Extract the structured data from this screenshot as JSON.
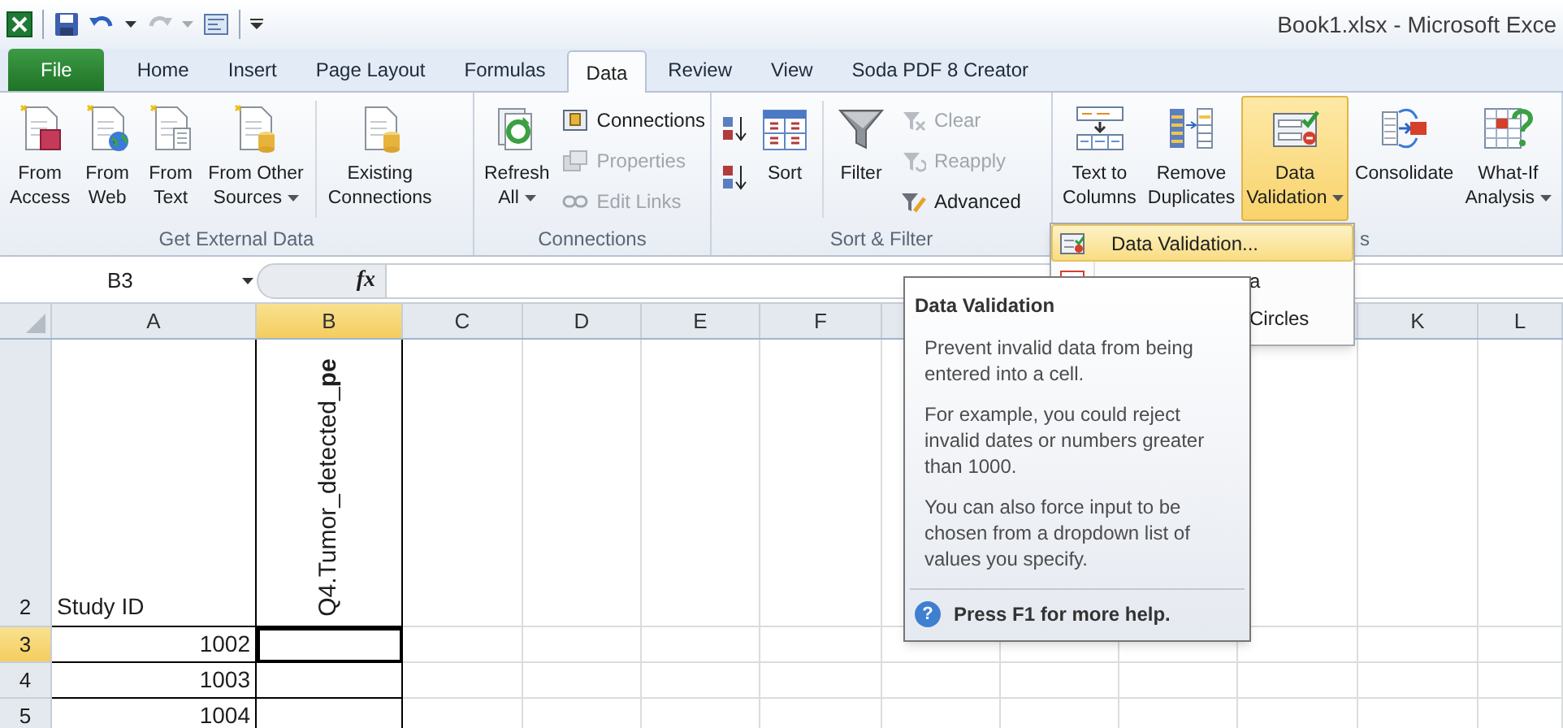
{
  "window": {
    "title": "Book1.xlsx - Microsoft Exce"
  },
  "tabs": [
    {
      "label": "File",
      "kind": "file",
      "selected": false
    },
    {
      "label": "Home",
      "kind": "tab",
      "selected": false
    },
    {
      "label": "Insert",
      "kind": "tab",
      "selected": false
    },
    {
      "label": "Page Layout",
      "kind": "tab",
      "selected": false
    },
    {
      "label": "Formulas",
      "kind": "tab",
      "selected": false
    },
    {
      "label": "Data",
      "kind": "tab",
      "selected": true
    },
    {
      "label": "Review",
      "kind": "tab",
      "selected": false
    },
    {
      "label": "View",
      "kind": "tab",
      "selected": false
    },
    {
      "label": "Soda PDF 8 Creator",
      "kind": "tab",
      "selected": false
    }
  ],
  "ribbon": {
    "groups": [
      {
        "label": "Get External Data",
        "items": [
          {
            "kind": "large",
            "lines": [
              "From",
              "Access"
            ],
            "dropdown": false,
            "selected": false
          },
          {
            "kind": "large",
            "lines": [
              "From",
              "Web"
            ],
            "dropdown": false,
            "selected": false
          },
          {
            "kind": "large",
            "lines": [
              "From",
              "Text"
            ],
            "dropdown": false,
            "selected": false
          },
          {
            "kind": "large",
            "lines": [
              "From Other",
              "Sources"
            ],
            "dropdown": true,
            "selected": false
          },
          {
            "kind": "separator"
          },
          {
            "kind": "large",
            "lines": [
              "Existing",
              "Connections"
            ],
            "dropdown": false,
            "selected": false
          }
        ]
      },
      {
        "label": "Connections",
        "items": [
          {
            "kind": "large",
            "lines": [
              "Refresh",
              "All"
            ],
            "dropdown": true,
            "selected": false
          },
          {
            "kind": "stack",
            "buttons": [
              {
                "label": "Connections",
                "disabled": false
              },
              {
                "label": "Properties",
                "disabled": true
              },
              {
                "label": "Edit Links",
                "disabled": true
              }
            ]
          }
        ]
      },
      {
        "label": "Sort & Filter",
        "items": [
          {
            "kind": "sort_pair"
          },
          {
            "kind": "large",
            "lines": [
              "Sort"
            ],
            "dropdown": false,
            "selected": false
          },
          {
            "kind": "separator"
          },
          {
            "kind": "large",
            "lines": [
              "Filter"
            ],
            "dropdown": false,
            "selected": false
          },
          {
            "kind": "stack",
            "buttons": [
              {
                "label": "Clear",
                "disabled": true
              },
              {
                "label": "Reapply",
                "disabled": true
              },
              {
                "label": "Advanced",
                "disabled": false
              }
            ]
          }
        ]
      },
      {
        "label": "s",
        "items": [
          {
            "kind": "large",
            "lines": [
              "Text to",
              "Columns"
            ],
            "dropdown": false,
            "selected": false
          },
          {
            "kind": "large",
            "lines": [
              "Remove",
              "Duplicates"
            ],
            "dropdown": false,
            "selected": false
          },
          {
            "kind": "large",
            "lines": [
              "Data",
              "Validation"
            ],
            "dropdown": true,
            "selected": true
          },
          {
            "kind": "large",
            "lines": [
              "Consolidate"
            ],
            "dropdown": false,
            "selected": false
          },
          {
            "kind": "large",
            "lines": [
              "What-If",
              "Analysis"
            ],
            "dropdown": true,
            "selected": false
          }
        ]
      }
    ]
  },
  "formula_bar": {
    "name_box": "B3",
    "fx": "fx"
  },
  "columns": [
    {
      "label": "A",
      "selected": false
    },
    {
      "label": "B",
      "selected": true
    },
    {
      "label": "C",
      "selected": false
    },
    {
      "label": "D",
      "selected": false
    },
    {
      "label": "E",
      "selected": false
    },
    {
      "label": "F",
      "selected": false
    },
    {
      "label": "K",
      "selected": false
    },
    {
      "label": "L",
      "selected": false
    }
  ],
  "rows": [
    {
      "header": "2",
      "selected": false,
      "cells": [
        {
          "kind": "text",
          "text": "Study ID"
        },
        {
          "kind": "rotated",
          "text": "Q4.Tumor_detected_**pe**"
        }
      ]
    },
    {
      "header": "3",
      "selected": true,
      "cells": [
        {
          "kind": "number",
          "text": "1002"
        }
      ]
    },
    {
      "header": "4",
      "selected": false,
      "cells": [
        {
          "kind": "number",
          "text": "1003"
        }
      ]
    },
    {
      "header": "5",
      "selected": false,
      "cells": [
        {
          "kind": "number",
          "text": "1004"
        }
      ]
    }
  ],
  "menu": {
    "items": [
      {
        "label": "Data Validation...",
        "selected": true
      },
      {
        "label": "a",
        "selected": false
      },
      {
        "label": "Circles",
        "selected": false
      }
    ]
  },
  "tooltip": {
    "title": "Data Validation",
    "paragraphs": [
      "Prevent invalid data from being entered into a cell.",
      "For example, you could reject invalid dates or numbers greater than 1000.",
      "You can also force input to be chosen from a dropdown list of values you specify."
    ],
    "help_icon": "?",
    "help": "Press F1 for more help."
  }
}
